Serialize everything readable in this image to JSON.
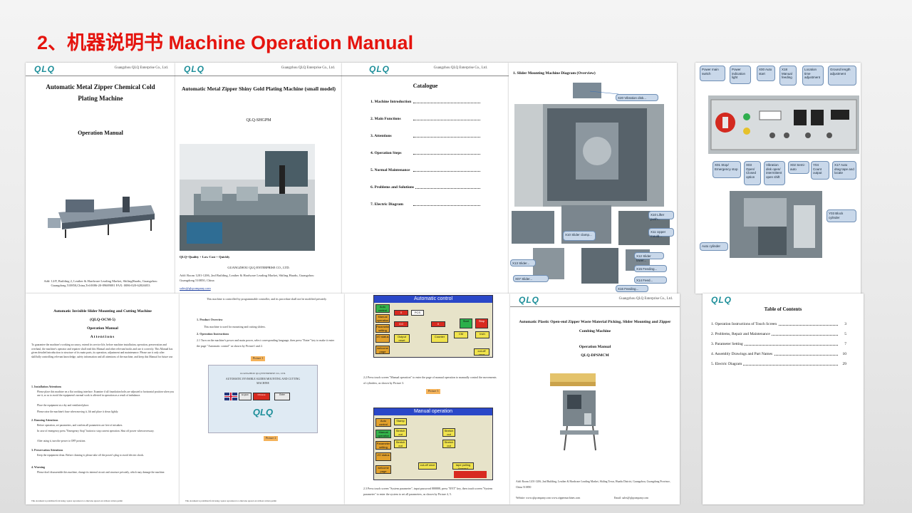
{
  "slide": {
    "title": "2、机器说明书 Machine Operation Manual",
    "title_color": "#e5140e"
  },
  "brand": {
    "logo": "QLQ",
    "header_company": "Guangzhou QLQ Enterprise Co., Ltd."
  },
  "doc1": {
    "title": "Automatic Metal Zipper Chemical Cold Plating Machine",
    "subtitle": "Operation Manual",
    "footer": "Add: 12/F, Building 2, Leather & Hardware Leading Market, ShilingHuadu, Guangzhou Guangdong 510850,China,Tel:0086-20-89689081  FAX: 0086-020-62826053"
  },
  "doc2": {
    "title": "Automatic Metal Zipper Shiny Gold Plating Machine (small model)",
    "model": "QLQ-SHGPM",
    "slogan": "QLQ=Quality + Low Cost + Quickly",
    "company": "GUANGZHOU QLQ ENTERPRISE CO., LTD.",
    "address": "Add: Room 1201-1206, 2nd Building, Leather & Hardware Leading Market, Shiling Huadu, Guangzhou Guangdong 510850, China",
    "email": "sales@qlqcompany.com"
  },
  "doc3": {
    "title": "Catalogue",
    "items": [
      "1. Machine Introduction",
      "2. Main Functions",
      "3. Attentions",
      "4. Operation Steps",
      "5. Normal Maintenance",
      "6. Problems and Solutions",
      "7. Electric Diagram"
    ]
  },
  "doc4": {
    "title": "1.  Slider Mounting Machine Diagram (Overview)",
    "labels": [
      "X20 Vibration disk... ",
      "X10 Lifter push...",
      "X11 Upper mould...",
      "X10 Slider clamp...",
      "X12 Slider lower...",
      "X15 Feeding...",
      "X13 Slider...",
      "X14 Feed...",
      "X16 Feeding...",
      "X07 Slider..."
    ]
  },
  "doc5": {
    "callouts_top": [
      "Power main switch",
      "Power indication light",
      "X00 Auto start",
      "X18 Manual feeding",
      "Location time adjustment",
      "Ground length adjustment"
    ],
    "callouts_bottom": [
      "X01 Stop/ Emergency stop",
      "X03 Open/ Closed option",
      "Vibration disk open/ intermittent open shift",
      "X02 Semi-auto",
      "Y04 Count output",
      "X17 Auto drag tape and locate"
    ],
    "callout_right": "Y03 Block cylinder",
    "callout_left": "Auto cylinder"
  },
  "doc6": {
    "title": "Automatic Invisible Slider Mounting and Cutting Machine",
    "model": "(QLQ-OCM-5)",
    "subtitle": "Operation Manual",
    "attentions": "Attentions",
    "intro": "To guarantee the machine's working accuracy, extend its service life, before machine installation, operation, preservation and overhaul, the machine's operator and repairer shall read this Manual and other relevant books and use it correctly. This Manual has given detailed introduction to structure of its main parts, its operation, adjustment and maintenance. Please use it only after skillfully controlling relevant knowledge, safety information and all attentions of the machine, and keep this Manual for future use.",
    "sections": [
      {
        "head": "1. Installation Attentions",
        "items": [
          "Please place this machine on a flat working interface. Examine if all foundation bolts are adjusted to horizontal position when you use it, so as to avoid the equipment's normal work is affected in operation as a result of imbalance.",
          "Place the equipment at a dry and ventilated place.",
          "Please raise the machine's base when moving it, lift and place it down lightly."
        ]
      },
      {
        "head": "2. Running Attentions",
        "items": [
          "Before operation, set parameters, and confirm all parameters are free of mistakes.",
          "In case of emergency press \"Emergency Stop\" button to stop current operation. Shut off power when necessary.",
          "After using it, turn the power to OFF position."
        ]
      },
      {
        "head": "3. Preservation Attentions",
        "items": [
          "Keep the equipment clean. Before cleaning it, please take off the power's plug to avoid electric shock."
        ]
      },
      {
        "head": "4. Warning",
        "items": [
          "Please don't disassemble this machine, change its internal circuit and structure privately, which may damage the machine."
        ]
      }
    ],
    "footnote": "This document is prohibited from being copied, reproduced or otherwise spread out without written permit"
  },
  "doc7": {
    "lines": [
      "This machine is controlled by programmable controller, and its procedure shall not be modified privately.",
      "1. Product Overview",
      "This machine is used for mounting and cutting sliders.",
      "2. Operation Instructions",
      "2.1 Turn on the machine's power and main power, select corresponding language, then press \"Enter\" key to make it enter the page \"Automatic control\" as shown by Picture1 and 2."
    ],
    "pic1": "Picture 1",
    "pic2": "Picture 2",
    "screen_company": "GUANGZHOU QLQ ENTERPRISE CO., LTD.",
    "screen_title": "AUTOMATIC INVISIBLE SLIDER MOUNTING AND CUTTING MACHINE",
    "lang1": "English",
    "lang2": "Chinese",
    "enter": "Enter",
    "footnote": "This document is prohibited from being copied, reproduced or otherwise spread out without written permit"
  },
  "doc8": {
    "auto_title": "Automatic control",
    "manual_title": "Manual operation",
    "text1": "2.2 Press touch screen \"Manual operation\" to enter the page of manual operation to manually control the movements of cylinders, as shown by Picture 3.",
    "pic": "Picture 3",
    "text2": "2.3 Press touch screen \"System parameter\", input password 888888, press \"ENT\" key, then touch screen \"System parameter\" to enter the system to set all parameters, as shown by Picture 4, 5.",
    "auto_labels": [
      "Auto control",
      "Manual operation",
      "Parameter setting",
      "I/O status",
      "welcome page",
      "Output reset",
      "Counter",
      "Start",
      "Stop",
      "CM",
      "Inch",
      "cut-off once"
    ],
    "auto_values": [
      "0",
      "PCS",
      "0.0",
      "0"
    ],
    "manual_labels": [
      "Auto control",
      "Manual operation",
      "Parameter setting",
      "I/O status",
      "welcome page",
      "Stamp",
      "Stretch out",
      "Stretch out",
      "Stretch out",
      "Stretch out",
      "cut-off once",
      "tape pulling forward"
    ]
  },
  "doc9": {
    "title": "Automatic Plastic Open-end Zipper Waste Material Picking, Slider Mounting and Zipper Combing Machine",
    "subtitle": "Operation Manual",
    "model": "QLQ-DPSMCM",
    "address": "Add: Room 1201-1206, 2nd Building, Leather & Hardware Leading Market, Shiling Town, Huadu District, Guangzhou, Guangdong Province, China 510850",
    "website": "Website: www.qlqcompany.com   www.zippermachines.com",
    "email": "Email: sales@qlqcompany.com"
  },
  "doc10": {
    "title": "Table of Contents",
    "items": [
      {
        "label": "1. Operation Instructions of Touch Screen",
        "page": "3"
      },
      {
        "label": "2. Problems, Repair and Maintenance",
        "page": "5"
      },
      {
        "label": "3. Parameter Setting",
        "page": "7"
      },
      {
        "label": "4. Assembly Drawings and Part Names",
        "page": "10"
      },
      {
        "label": "5. Electric Diagram",
        "page": "29"
      }
    ]
  }
}
